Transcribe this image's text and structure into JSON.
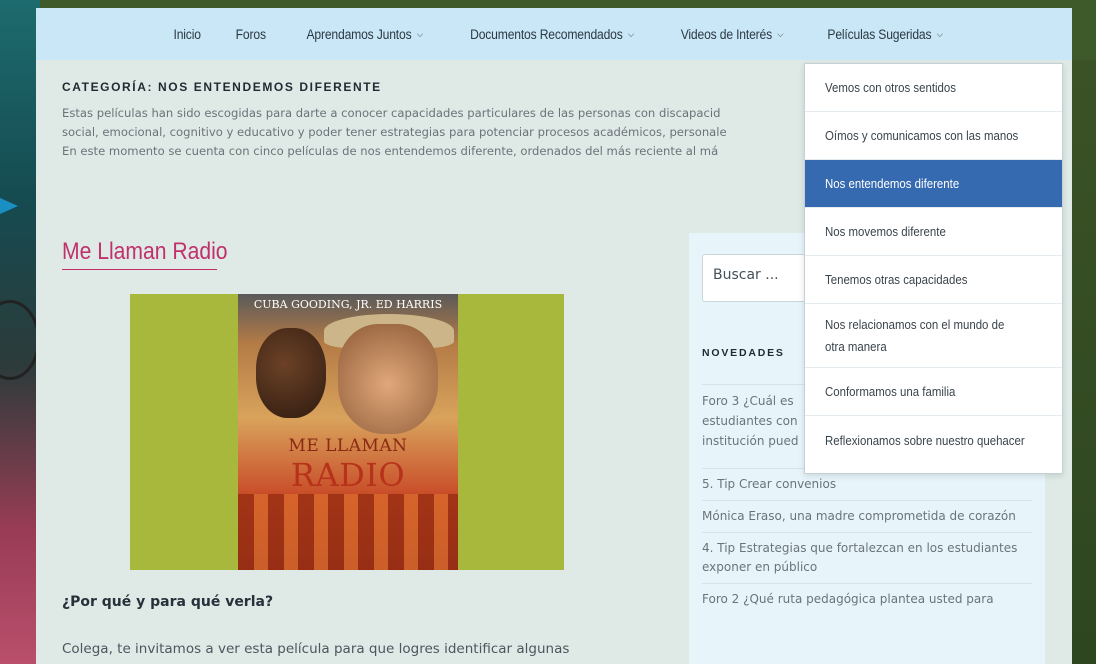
{
  "nav": {
    "items": [
      {
        "label": "Inicio",
        "chevron": false
      },
      {
        "label": "Foros",
        "chevron": false
      },
      {
        "label": "Aprendamos Juntos",
        "chevron": true
      },
      {
        "label": "Documentos Recomendados",
        "chevron": true
      },
      {
        "label": "Videos de Interés",
        "chevron": true
      },
      {
        "label": "Películas Sugeridas",
        "chevron": true
      }
    ]
  },
  "category": {
    "title": "CATEGORÍA: NOS ENTENDEMOS DIFERENTE",
    "desc_line1": "Estas películas han sido escogidas para darte a conocer capacidades particulares de las personas con discapacid",
    "desc_line2": "social, emocional, cognitivo y educativo y poder tener estrategias para potenciar procesos académicos, personale",
    "desc_line3": "En este momento se cuenta con cinco películas de nos entendemos diferente, ordenados del más reciente al má"
  },
  "post": {
    "title": "Me Llaman Radio",
    "poster_actors": "CUBA GOODING, JR.   ED HARRIS",
    "poster_title_small": "ME LLAMAN",
    "poster_title_big": "RADIO",
    "subheading": "¿Por qué y para qué verla?",
    "body": "Colega, te invitamos a ver esta película para que logres identificar algunas"
  },
  "sidebar": {
    "search_placeholder": "Buscar ...",
    "widget_title": "NOVEDADES",
    "news": [
      "Foro 3 ¿Cuál es estudiantes con institución pued",
      "5. Tip Crear convenios",
      "Mónica Eraso, una madre comprometida de corazón",
      "4. Tip Estrategias que fortalezcan en los estudiantes exponer en público",
      "Foro 2 ¿Qué ruta pedagógica plantea usted para"
    ]
  },
  "dropdown": {
    "items": [
      "Vemos con otros sentidos",
      "Oímos y comunicamos con las manos",
      "Nos entendemos diferente",
      "Nos movemos diferente",
      "Tenemos otras capacidades",
      "Nos relacionamos con el mundo de otra manera",
      "Conformamos una familia",
      "Reflexionamos sobre nuestro quehacer"
    ],
    "active_index": 2
  },
  "colors": {
    "accent": "#3569b0",
    "title_pink": "#c0316b",
    "nav_bg": "#c9e7f7"
  }
}
